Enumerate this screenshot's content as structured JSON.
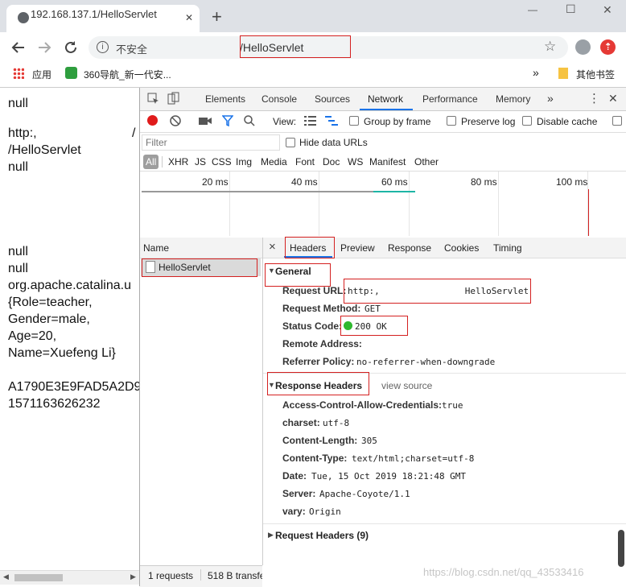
{
  "browser": {
    "tab_title": "192.168.137.1/HelloServlet",
    "tab_close": "✕",
    "new_tab": "+",
    "window_controls": [
      "—",
      "☐",
      "✕"
    ],
    "security_label": "不安全",
    "url_path": "/HelloServlet",
    "bookmarks": {
      "apps": "应用",
      "nav360": "360导航_新一代安...",
      "more": "»",
      "other": "其他书签"
    }
  },
  "page": {
    "lines": [
      "null",
      "http:,",
      "/HelloServlet",
      "null",
      "null",
      "null",
      "org.apache.catalina.u",
      "{Role=teacher,",
      "Gender=male,",
      "Age=20,",
      "Name=Xuefeng Li}",
      "A1790E3E9FAD5A2D9",
      "1571163626232"
    ],
    "slash_mark": "/"
  },
  "devtools": {
    "tabs": [
      "Elements",
      "Console",
      "Sources",
      "Network",
      "Performance",
      "Memory"
    ],
    "active_tab": "Network",
    "more": "»",
    "toolbar": {
      "view_label": "View:",
      "group_by_frame": "Group by frame",
      "preserve_log": "Preserve log",
      "disable_cache": "Disable cache"
    },
    "filter_placeholder": "Filter",
    "hide_data_urls": "Hide data URLs",
    "type_filters": [
      "All",
      "XHR",
      "JS",
      "CSS",
      "Img",
      "Media",
      "Font",
      "Doc",
      "WS",
      "Manifest",
      "Other"
    ],
    "timeline_ticks": [
      "20 ms",
      "40 ms",
      "60 ms",
      "80 ms",
      "100 ms"
    ],
    "name_header": "Name",
    "request_name": "HelloServlet",
    "status_bar": {
      "requests": "1 requests",
      "transferred": "518 B transfe"
    },
    "detail_close": "×",
    "detail_tabs": [
      "Headers",
      "Preview",
      "Response",
      "Cookies",
      "Timing"
    ],
    "active_detail_tab": "Headers",
    "general": {
      "title": "General",
      "rows": [
        {
          "key": "Request URL:",
          "value": "http:,                HelloServlet"
        },
        {
          "key": "Request Method:",
          "value": "GET"
        },
        {
          "key": "Status Code:",
          "value": "200 OK"
        },
        {
          "key": "Remote Address:",
          "value": ""
        },
        {
          "key": "Referrer Policy:",
          "value": "no-referrer-when-downgrade"
        }
      ]
    },
    "response_headers": {
      "title": "Response Headers",
      "view_source": "view source",
      "rows": [
        {
          "key": "Access-Control-Allow-Credentials:",
          "value": "true"
        },
        {
          "key": "charset:",
          "value": "utf-8"
        },
        {
          "key": "Content-Length:",
          "value": "305"
        },
        {
          "key": "Content-Type:",
          "value": "text/html;charset=utf-8"
        },
        {
          "key": "Date:",
          "value": "Tue, 15 Oct 2019 18:21:48 GMT"
        },
        {
          "key": "Server:",
          "value": "Apache-Coyote/1.1"
        },
        {
          "key": "vary:",
          "value": "Origin"
        }
      ]
    },
    "request_headers": {
      "title": "Request Headers (9)"
    },
    "colors": {
      "accent": "#1a73e8",
      "status_ok": "#2eb82e",
      "record": "#e01b1b",
      "annotation": "#d42020"
    }
  },
  "watermark": "https://blog.csdn.net/qq_43533416"
}
